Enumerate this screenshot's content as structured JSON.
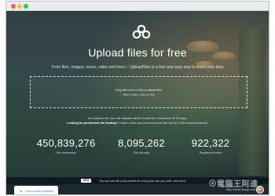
{
  "hero": {
    "title": "Upload files for free",
    "subtitle": "From files, images, music, video and more – UploadFiles is a free and easy way to share your data",
    "dropzone": {
      "main": "Drop files here or click to upload files",
      "sub": "(Max 10 files, 2GB per file)"
    },
    "guest_notice": "As a guest user, your file uploads will be hosted for a maximum of 30 days.",
    "guest_cta_bold": "Looking for permanent file hosting?",
    "guest_cta_rest": "Create a free account and unlock the full set of file sharing features."
  },
  "stats": [
    {
      "value": "450,839,276",
      "label": "File downloads"
    },
    {
      "value": "8,095,262",
      "label": "File uploads"
    },
    {
      "value": "922,322",
      "label": "Registered users"
    }
  ],
  "notice": {
    "badge": "NEW",
    "text": "You can earn $5 every month for every paid user you refer, click here!"
  },
  "bottombar": {
    "recent_uploads": "Your recent uploads"
  },
  "watermark": {
    "text": "電腦王阿達",
    "url": "http://www.kocpc.com.tw"
  },
  "colors": {
    "accent": "#2a7fd4",
    "hero_bg": "#2f3f44",
    "notice_bg": "#101a1e"
  },
  "icons": {
    "logo": "cloud-logo-icon",
    "recent": "arrow-up-icon",
    "avatar": "user-avatar"
  }
}
